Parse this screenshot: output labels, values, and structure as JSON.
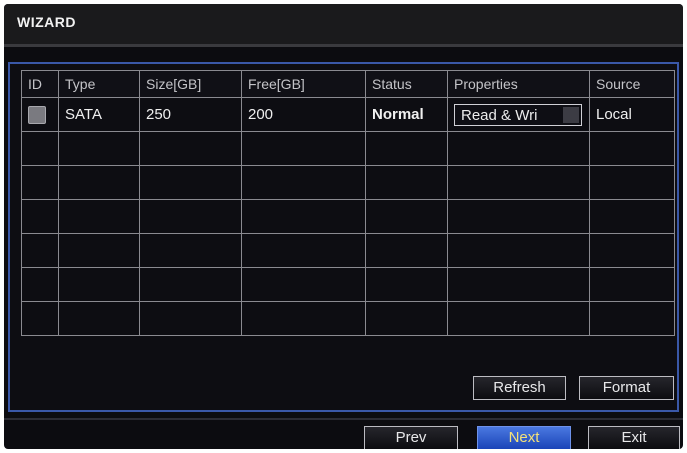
{
  "window": {
    "title": "WIZARD"
  },
  "table": {
    "columns": [
      "ID",
      "Type",
      "Size[GB]",
      "Free[GB]",
      "Status",
      "Properties",
      "Source"
    ],
    "rows": [
      {
        "id_checked": false,
        "type": "SATA",
        "size": "250",
        "free": "200",
        "status": "Normal",
        "properties": "Read & Wri",
        "source": "Local"
      }
    ],
    "empty_rows": 6
  },
  "actions": {
    "refresh_label": "Refresh",
    "format_label": "Format"
  },
  "nav": {
    "prev_label": "Prev",
    "next_label": "Next",
    "exit_label": "Exit"
  },
  "colors": {
    "background": "#0c0c10",
    "panel_border": "#3a58a8",
    "grid_line": "#8a8a90",
    "next_button_fill": "#2a5ad0",
    "next_button_text": "#f4e27a"
  }
}
